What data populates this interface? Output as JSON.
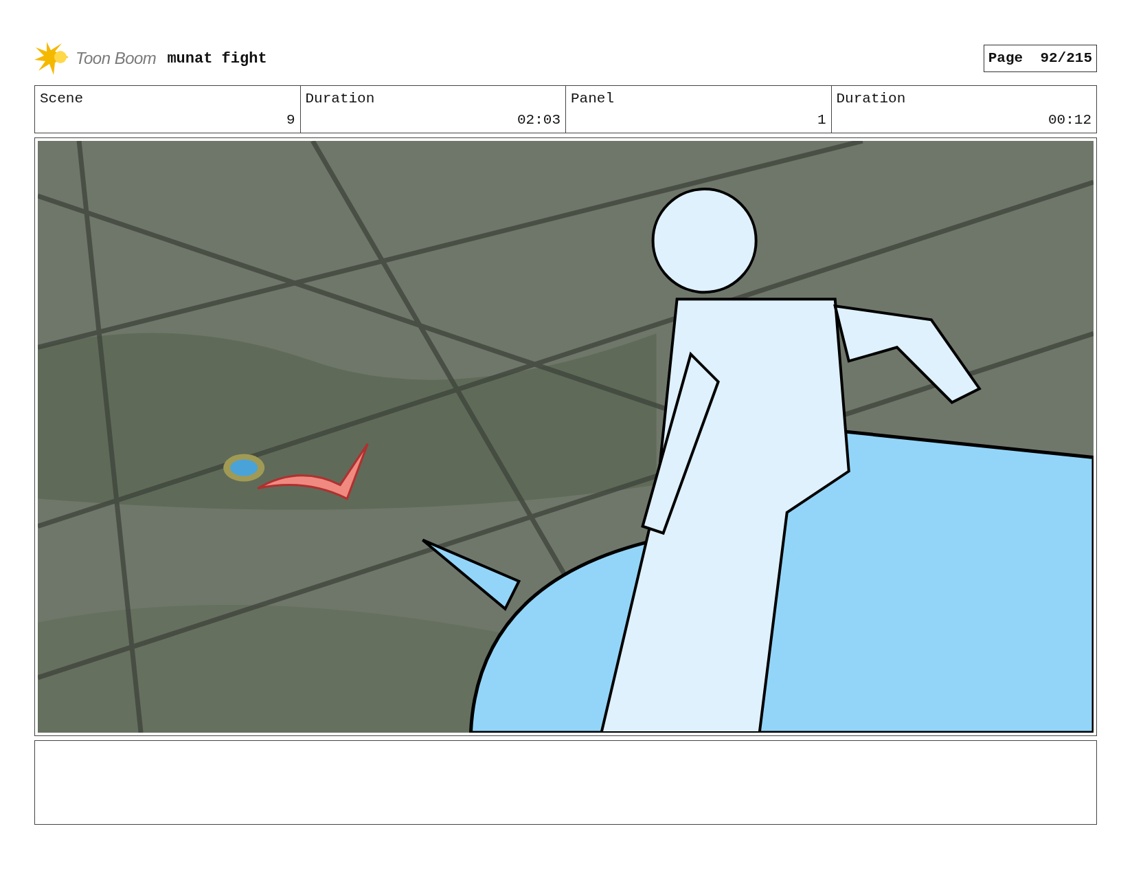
{
  "header": {
    "logo": "Toon Boom",
    "title": "munat fight",
    "page": "Page  92/215"
  },
  "info_table": {
    "columns": [
      "Scene",
      "Duration",
      "Panel",
      "Duration"
    ],
    "rows": [
      [
        "9",
        "02:03",
        "1",
        "00:12"
      ]
    ]
  },
  "panel_picture": {
    "kind": "figure-picture"
  }
}
